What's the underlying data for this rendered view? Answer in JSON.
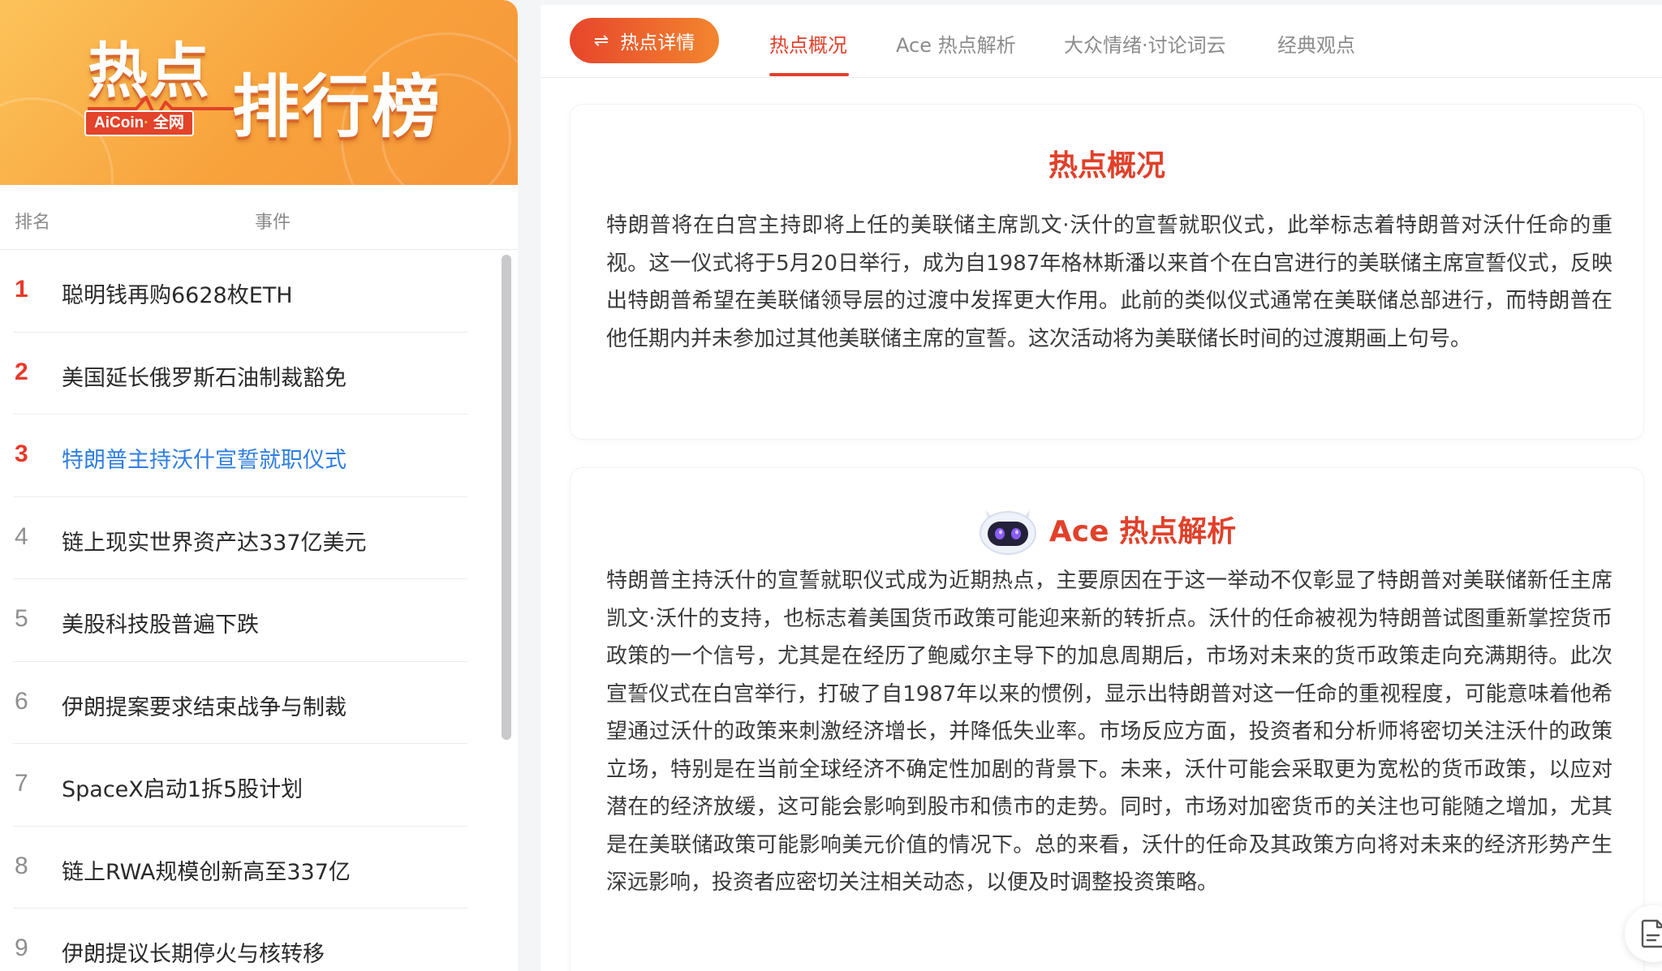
{
  "banner": {
    "title_line1": "热点",
    "title_line2": "排行榜",
    "tag_brand": "AiCoin",
    "tag_dot": "·",
    "tag_scope": "全网"
  },
  "table": {
    "col_rank": "排名",
    "col_event": "事件"
  },
  "ranking": [
    {
      "rank": "1",
      "title": "聪明钱再购6628枚ETH"
    },
    {
      "rank": "2",
      "title": "美国延长俄罗斯石油制裁豁免"
    },
    {
      "rank": "3",
      "title": "特朗普主持沃什宣誓就职仪式"
    },
    {
      "rank": "4",
      "title": "链上现实世界资产达337亿美元"
    },
    {
      "rank": "5",
      "title": "美股科技股普遍下跌"
    },
    {
      "rank": "6",
      "title": "伊朗提案要求结束战争与制裁"
    },
    {
      "rank": "7",
      "title": "SpaceX启动1拆5股计划"
    },
    {
      "rank": "8",
      "title": "链上RWA规模创新高至337亿"
    },
    {
      "rank": "9",
      "title": "伊朗提议长期停火与核转移"
    }
  ],
  "active_rank": 3,
  "toolbar": {
    "hot_detail_icon": "⇌",
    "hot_detail_label": "热点详情"
  },
  "tabs": [
    {
      "label": "热点概况"
    },
    {
      "label": "Ace 热点解析"
    },
    {
      "label": "大众情绪·讨论词云"
    },
    {
      "label": "经典观点"
    }
  ],
  "overview": {
    "title": "热点概况",
    "body": "特朗普将在白宫主持即将上任的美联储主席凯文·沃什的宣誓就职仪式，此举标志着特朗普对沃什任命的重视。这一仪式将于5月20日举行，成为自1987年格林斯潘以来首个在白宫进行的美联储主席宣誓仪式，反映出特朗普希望在美联储领导层的过渡中发挥更大作用。此前的类似仪式通常在美联储总部进行，而特朗普在他任期内并未参加过其他美联储主席的宣誓。这次活动将为美联储长时间的过渡期画上句号。"
  },
  "analysis": {
    "title": "Ace 热点解析",
    "body": "特朗普主持沃什的宣誓就职仪式成为近期热点，主要原因在于这一举动不仅彰显了特朗普对美联储新任主席凯文·沃什的支持，也标志着美国货币政策可能迎来新的转折点。沃什的任命被视为特朗普试图重新掌控货币政策的一个信号，尤其是在经历了鲍威尔主导下的加息周期后，市场对未来的货币政策走向充满期待。此次宣誓仪式在白宫举行，打破了自1987年以来的惯例，显示出特朗普对这一任命的重视程度，可能意味着他希望通过沃什的政策来刺激经济增长，并降低失业率。市场反应方面，投资者和分析师将密切关注沃什的政策立场，特别是在当前全球经济不确定性加剧的背景下。未来，沃什可能会采取更为宽松的货币政策，以应对潜在的经济放缓，这可能会影响到股市和债市的走势。同时，市场对加密货币的关注也可能随之增加，尤其是在美联储政策可能影响美元价值的情况下。总的来看，沃什的任命及其政策方向将对未来的经济形势产生深远影响，投资者应密切关注相关动态，以便及时调整投资策略。"
  },
  "colors": {
    "accent": "#e2402b",
    "link_active": "#2f7ee0",
    "banner_start": "#fcc35a",
    "banner_end": "#f6953a"
  },
  "icons": {
    "swap": "swap-arrows-icon",
    "robot": "ace-robot-icon",
    "document": "document-icon"
  }
}
